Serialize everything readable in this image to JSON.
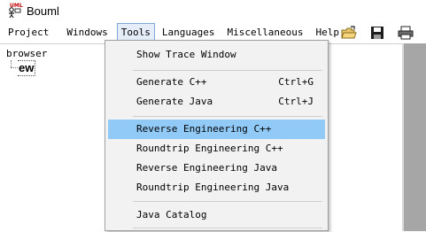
{
  "window": {
    "title": "Bouml",
    "icon": "bouml-app-icon"
  },
  "menubar": {
    "items": [
      "Project",
      "Windows",
      "Tools",
      "Languages",
      "Miscellaneous",
      "Help"
    ],
    "active_index": 2
  },
  "toolbar": {
    "icons": [
      "open-folder-icon",
      "save-icon",
      "print-icon"
    ]
  },
  "browser": {
    "label": "browser",
    "node_label": "ew"
  },
  "tools_menu": {
    "items": [
      {
        "label": "Show Trace Window",
        "shortcut": ""
      },
      {
        "label": "Generate C++",
        "shortcut": "Ctrl+G"
      },
      {
        "label": "Generate Java",
        "shortcut": "Ctrl+J"
      },
      {
        "label": "Reverse Engineering C++",
        "shortcut": "",
        "highlighted": true
      },
      {
        "label": "Roundtrip Engineering C++",
        "shortcut": ""
      },
      {
        "label": "Reverse Engineering Java",
        "shortcut": ""
      },
      {
        "label": "Roundtrip Engineering Java",
        "shortcut": ""
      },
      {
        "label": "Java Catalog",
        "shortcut": ""
      }
    ]
  },
  "colors": {
    "highlight": "#91c9f7",
    "menu_active_bg": "#e5eef8",
    "menu_active_border": "#7fa8d8",
    "dropdown_bg": "#f2f2f2",
    "right_pane": "#a6a6a6"
  }
}
